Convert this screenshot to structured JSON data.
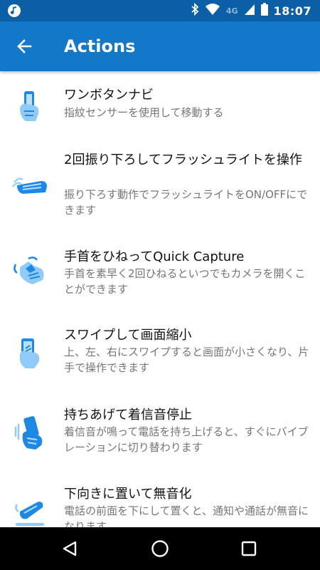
{
  "status_bar": {
    "time": "18:07",
    "network": "4G",
    "icons": [
      "music-icon",
      "bluetooth-icon",
      "wifi-icon",
      "signal-icon",
      "battery-icon"
    ]
  },
  "app_bar": {
    "title": "Actions",
    "back_icon": "arrow-left-icon"
  },
  "items": [
    {
      "title": "ワンボタンナビ",
      "description": "指紋センサーを使用して移動する",
      "icon": "phone-hand-icon"
    },
    {
      "title": "2回振り下ろしてフラッシュライトを操作",
      "description": "振り下ろす動作でフラッシュライトをON/OFFにできます",
      "icon": "chop-hand-icon"
    },
    {
      "title": "手首をひねってQuick Capture",
      "description": "手首を素早く2回ひねるといつでもカメラを開くことができます",
      "icon": "twist-hand-icon"
    },
    {
      "title": "スワイプして画面縮小",
      "description": "上、左、右にスワイプすると画面が小さくなり、片手で操作できます",
      "icon": "swipe-hand-icon"
    },
    {
      "title": "持ちあげて着信音停止",
      "description": "着信音が鳴って電話を持ち上げると、すぐにバイブレーションに切り替わります",
      "icon": "pickup-hand-icon"
    },
    {
      "title": "下向きに置いて無音化",
      "description": "電話の前面を下にして置くと、通知や通話が無音になります",
      "icon": "flip-phone-icon"
    }
  ],
  "colors": {
    "status_bar": "#0a5fa6",
    "app_bar": "#1478c8",
    "icon_blue": "#1e88e5",
    "icon_light": "#90caf9",
    "title_text": "#111111",
    "desc_text": "#757575"
  },
  "nav_bar": {
    "icons": [
      "back-triangle-icon",
      "home-circle-icon",
      "recents-square-icon"
    ]
  }
}
